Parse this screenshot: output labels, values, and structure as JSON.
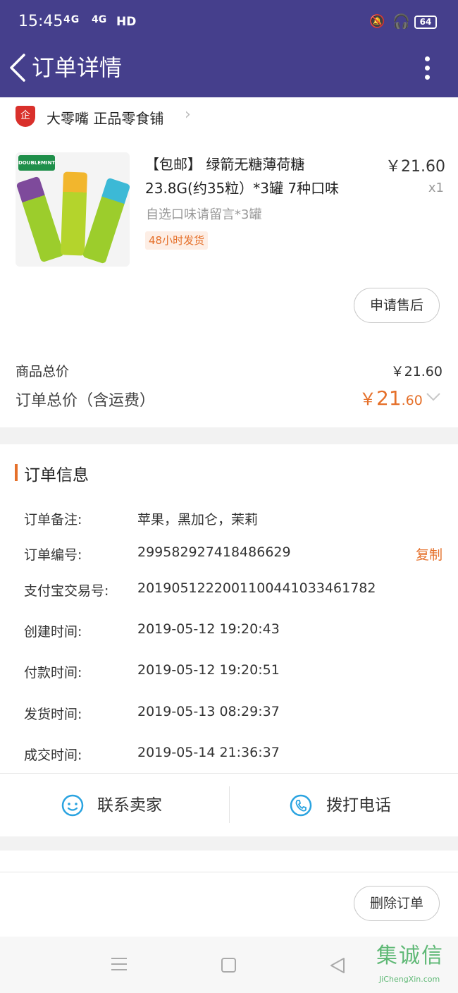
{
  "status_bar": {
    "time": "15:45",
    "network1": "4G",
    "network2": "4G",
    "hd": "HD",
    "battery": "64"
  },
  "header": {
    "title": "订单详情"
  },
  "shop": {
    "icon_text": "企",
    "name": "大零嘴 正品零食铺"
  },
  "product": {
    "image_brand": "DOUBLEMINT",
    "title_line1": "【包邮】 绿箭无糖薄荷糖",
    "title_line2": "23.8G(约35粒）*3罐  7种口味",
    "price": "￥21.60",
    "quantity": "x1",
    "note": "自选口味请留言*3罐",
    "tag": "48小时发货",
    "after_sale_label": "申请售后"
  },
  "totals": {
    "goods_label": "商品总价",
    "goods_value": "￥21.60",
    "order_label": "订单总价（含运费）",
    "order_currency": "￥",
    "order_int": "21",
    "order_dec": ".60"
  },
  "order_info": {
    "section_title": "订单信息",
    "copy_label": "复制",
    "rows": [
      {
        "label": "订单备注:",
        "value": "苹果，黑加仑，茉莉"
      },
      {
        "label": "订单编号:",
        "value": "299582927418486629"
      },
      {
        "label": "支付宝交易号:",
        "value": "2019051222001100441033461782"
      },
      {
        "label": "创建时间:",
        "value": "2019-05-12 19:20:43"
      },
      {
        "label": "付款时间:",
        "value": "2019-05-12 19:20:51"
      },
      {
        "label": "发货时间:",
        "value": "2019-05-13 08:29:37"
      },
      {
        "label": "成交时间:",
        "value": "2019-05-14 21:36:37"
      }
    ]
  },
  "contact": {
    "seller_label": "联系卖家",
    "phone_label": "拨打电话"
  },
  "actions": {
    "delete_label": "删除订单"
  },
  "watermark": {
    "logo": "集诚信",
    "site": "JiChengXin.com"
  },
  "colors": {
    "header_bg": "#453f8c",
    "accent": "#e5702a",
    "icon_blue": "#2aa3e0"
  }
}
